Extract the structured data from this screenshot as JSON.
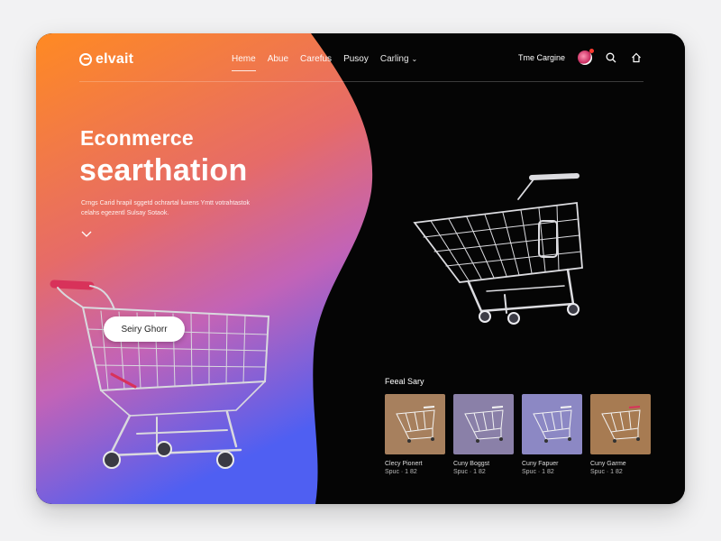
{
  "brand": {
    "name": "elvait"
  },
  "nav": {
    "items": [
      {
        "label": "Heme",
        "active": true
      },
      {
        "label": "Abue",
        "active": false
      },
      {
        "label": "Carefus",
        "active": false
      },
      {
        "label": "Pusoy",
        "active": false
      },
      {
        "label": "Carling",
        "active": false,
        "dropdown": true
      }
    ],
    "account_label": "Tme Cargine",
    "icons": [
      "avatar",
      "search-icon",
      "home-icon"
    ]
  },
  "hero": {
    "title_line1": "Econmerce",
    "title_line2": "searthation",
    "description": "Crngs Carid hrapil sggetd ochrartal luxens Ymtt votrahtastok celahs egezentl Sulsay Sotaok.",
    "cta_label": "Seiry Ghorr"
  },
  "featured": {
    "title": "Feeal Sary",
    "products": [
      {
        "name": "Clecy Pionert",
        "price": "Spuc · 1 82",
        "bg": "#a7805e"
      },
      {
        "name": "Cuny Boggst",
        "price": "Spuc · 1 82",
        "bg": "#8a80a8"
      },
      {
        "name": "Cuny Fapuer",
        "price": "Spuc · 1 82",
        "bg": "#8c88c4"
      },
      {
        "name": "Cuny Garme",
        "price": "Spuc · 1 82",
        "bg": "#a77b52"
      }
    ]
  },
  "colors": {
    "gradient_top": "#ff8a2a",
    "gradient_mid": "#e45f8a",
    "gradient_bottom": "#4f5ff2",
    "dark_panel": "#050505",
    "handle_red": "#d8325a"
  }
}
